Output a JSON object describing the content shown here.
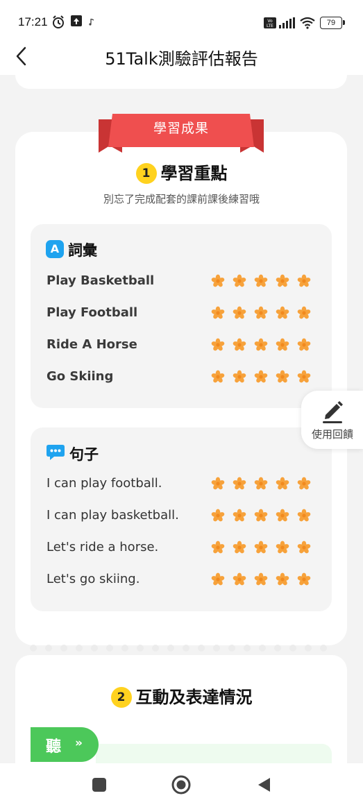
{
  "status_bar": {
    "time": "17:21",
    "battery": "79",
    "icons": [
      "alarm-icon",
      "upload-icon",
      "music-note-icon",
      "volte-icon",
      "signal-icon",
      "wifi-icon",
      "battery-icon"
    ]
  },
  "nav": {
    "title": "51Talk測驗評估報告",
    "back_icon": "chevron-left-icon"
  },
  "ribbon": {
    "label": "學習成果",
    "color": "#ef4f4f"
  },
  "section1": {
    "number": "1",
    "title": "學習重點",
    "subtitle": "別忘了完成配套的課前課後練習哦"
  },
  "vocab": {
    "icon_letter": "A",
    "title": "詞彙",
    "items": [
      {
        "label": "Play Basketball",
        "stars": 5
      },
      {
        "label": "Play Football",
        "stars": 5
      },
      {
        "label": "Ride A Horse",
        "stars": 5
      },
      {
        "label": "Go Skiing",
        "stars": 5
      }
    ]
  },
  "sentences": {
    "title": "句子",
    "items": [
      {
        "label": "I can play football.",
        "stars": 5
      },
      {
        "label": "I can play basketball.",
        "stars": 5
      },
      {
        "label": "Let's ride a horse.",
        "stars": 5
      },
      {
        "label": "Let's go skiing.",
        "stars": 5
      }
    ]
  },
  "feedback": {
    "label": "使用回饋"
  },
  "section2": {
    "number": "2",
    "title": "互動及表達情況"
  },
  "listen_tag": {
    "label": "聽"
  },
  "colors": {
    "star": "#f7a23b",
    "accent_blue": "#1fa3ef",
    "green": "#4cc85a",
    "badge_yellow": "#ffd21f"
  }
}
